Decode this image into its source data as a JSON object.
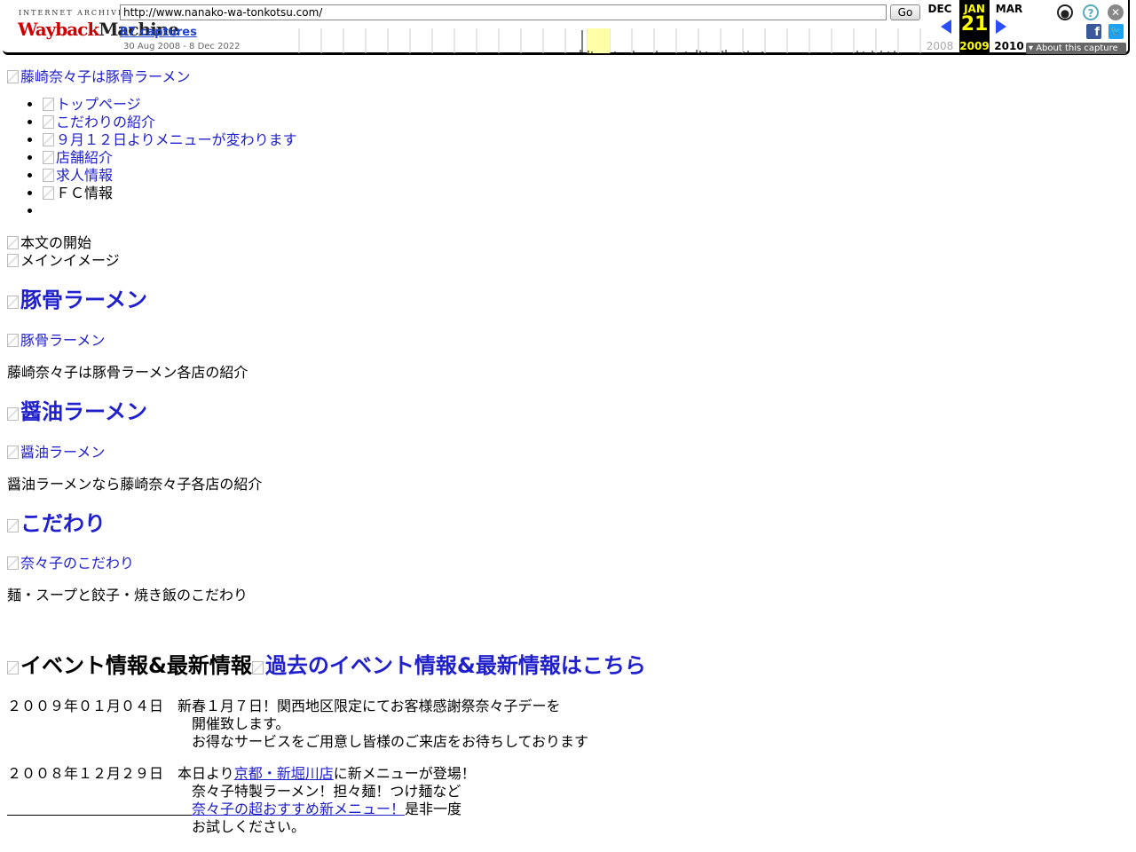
{
  "toolbar": {
    "ia_label": "INTERNET ARCHIVE",
    "logo_red": "Wayback",
    "logo_dark": "Machine",
    "url": "http://www.nanako-wa-tonkotsu.com/",
    "go_label": "Go",
    "captures_label": "87 captures",
    "date_range": "30 Aug 2008 - 8 Dec 2022",
    "prev_month": "DEC",
    "prev_year": "2008",
    "cur_month": "JAN",
    "cur_day": "21",
    "cur_year": "2009",
    "next_month": "MAR",
    "next_year": "2010",
    "about_label": "About this capture",
    "sparkline_highlight_color": "#ffffa8"
  },
  "page": {
    "logo_alt": "藤崎奈々子は豚骨ラーメン",
    "nav": [
      {
        "label": "トップページ",
        "link": true
      },
      {
        "label": "こだわりの紹介",
        "link": true
      },
      {
        "label": "９月１２日よりメニューが変わります",
        "link": true
      },
      {
        "label": "店舗紹介",
        "link": true
      },
      {
        "label": "求人情報",
        "link": true
      },
      {
        "label": "ＦＣ情報",
        "link": false
      },
      {
        "label": "",
        "link": false
      }
    ],
    "content_start_alt": "本文の開始",
    "main_image_alt": "メインイメージ",
    "sections": [
      {
        "heading": "豚骨ラーメン",
        "image_alt": "豚骨ラーメン",
        "description": "藤崎奈々子は豚骨ラーメン各店の紹介"
      },
      {
        "heading": "醤油ラーメン",
        "image_alt": "醤油ラーメン",
        "description": "醤油ラーメンなら藤崎奈々子各店の紹介"
      },
      {
        "heading": "こだわり",
        "image_alt": "奈々子のこだわり",
        "description": "麺・スープと餃子・焼き飯のこだわり"
      }
    ],
    "event_heading_alt": "イベント情報&最新情報",
    "event_past_link": "過去のイベント情報&最新情報はこちら",
    "news": [
      {
        "date": "２００９年０１月０４日",
        "line1": "新春１月７日！関西地区限定にてお客様感謝祭奈々子デーを",
        "line2": "開催致します。",
        "line3": "お得なサービスをご用意し皆様のご来店をお待ちしております"
      },
      {
        "date": "２００８年１２月２９日",
        "line1_pre": "本日より",
        "line1_link": "京都・新堀川店",
        "line1_post": "に新メニューが登場！",
        "line2": "奈々子特製ラーメン！担々麺！つけ麺など",
        "line3_link": "奈々子の超おすすめ新メニュー！",
        "line3_post": "是非一度",
        "line4": "お試しください。"
      }
    ]
  }
}
